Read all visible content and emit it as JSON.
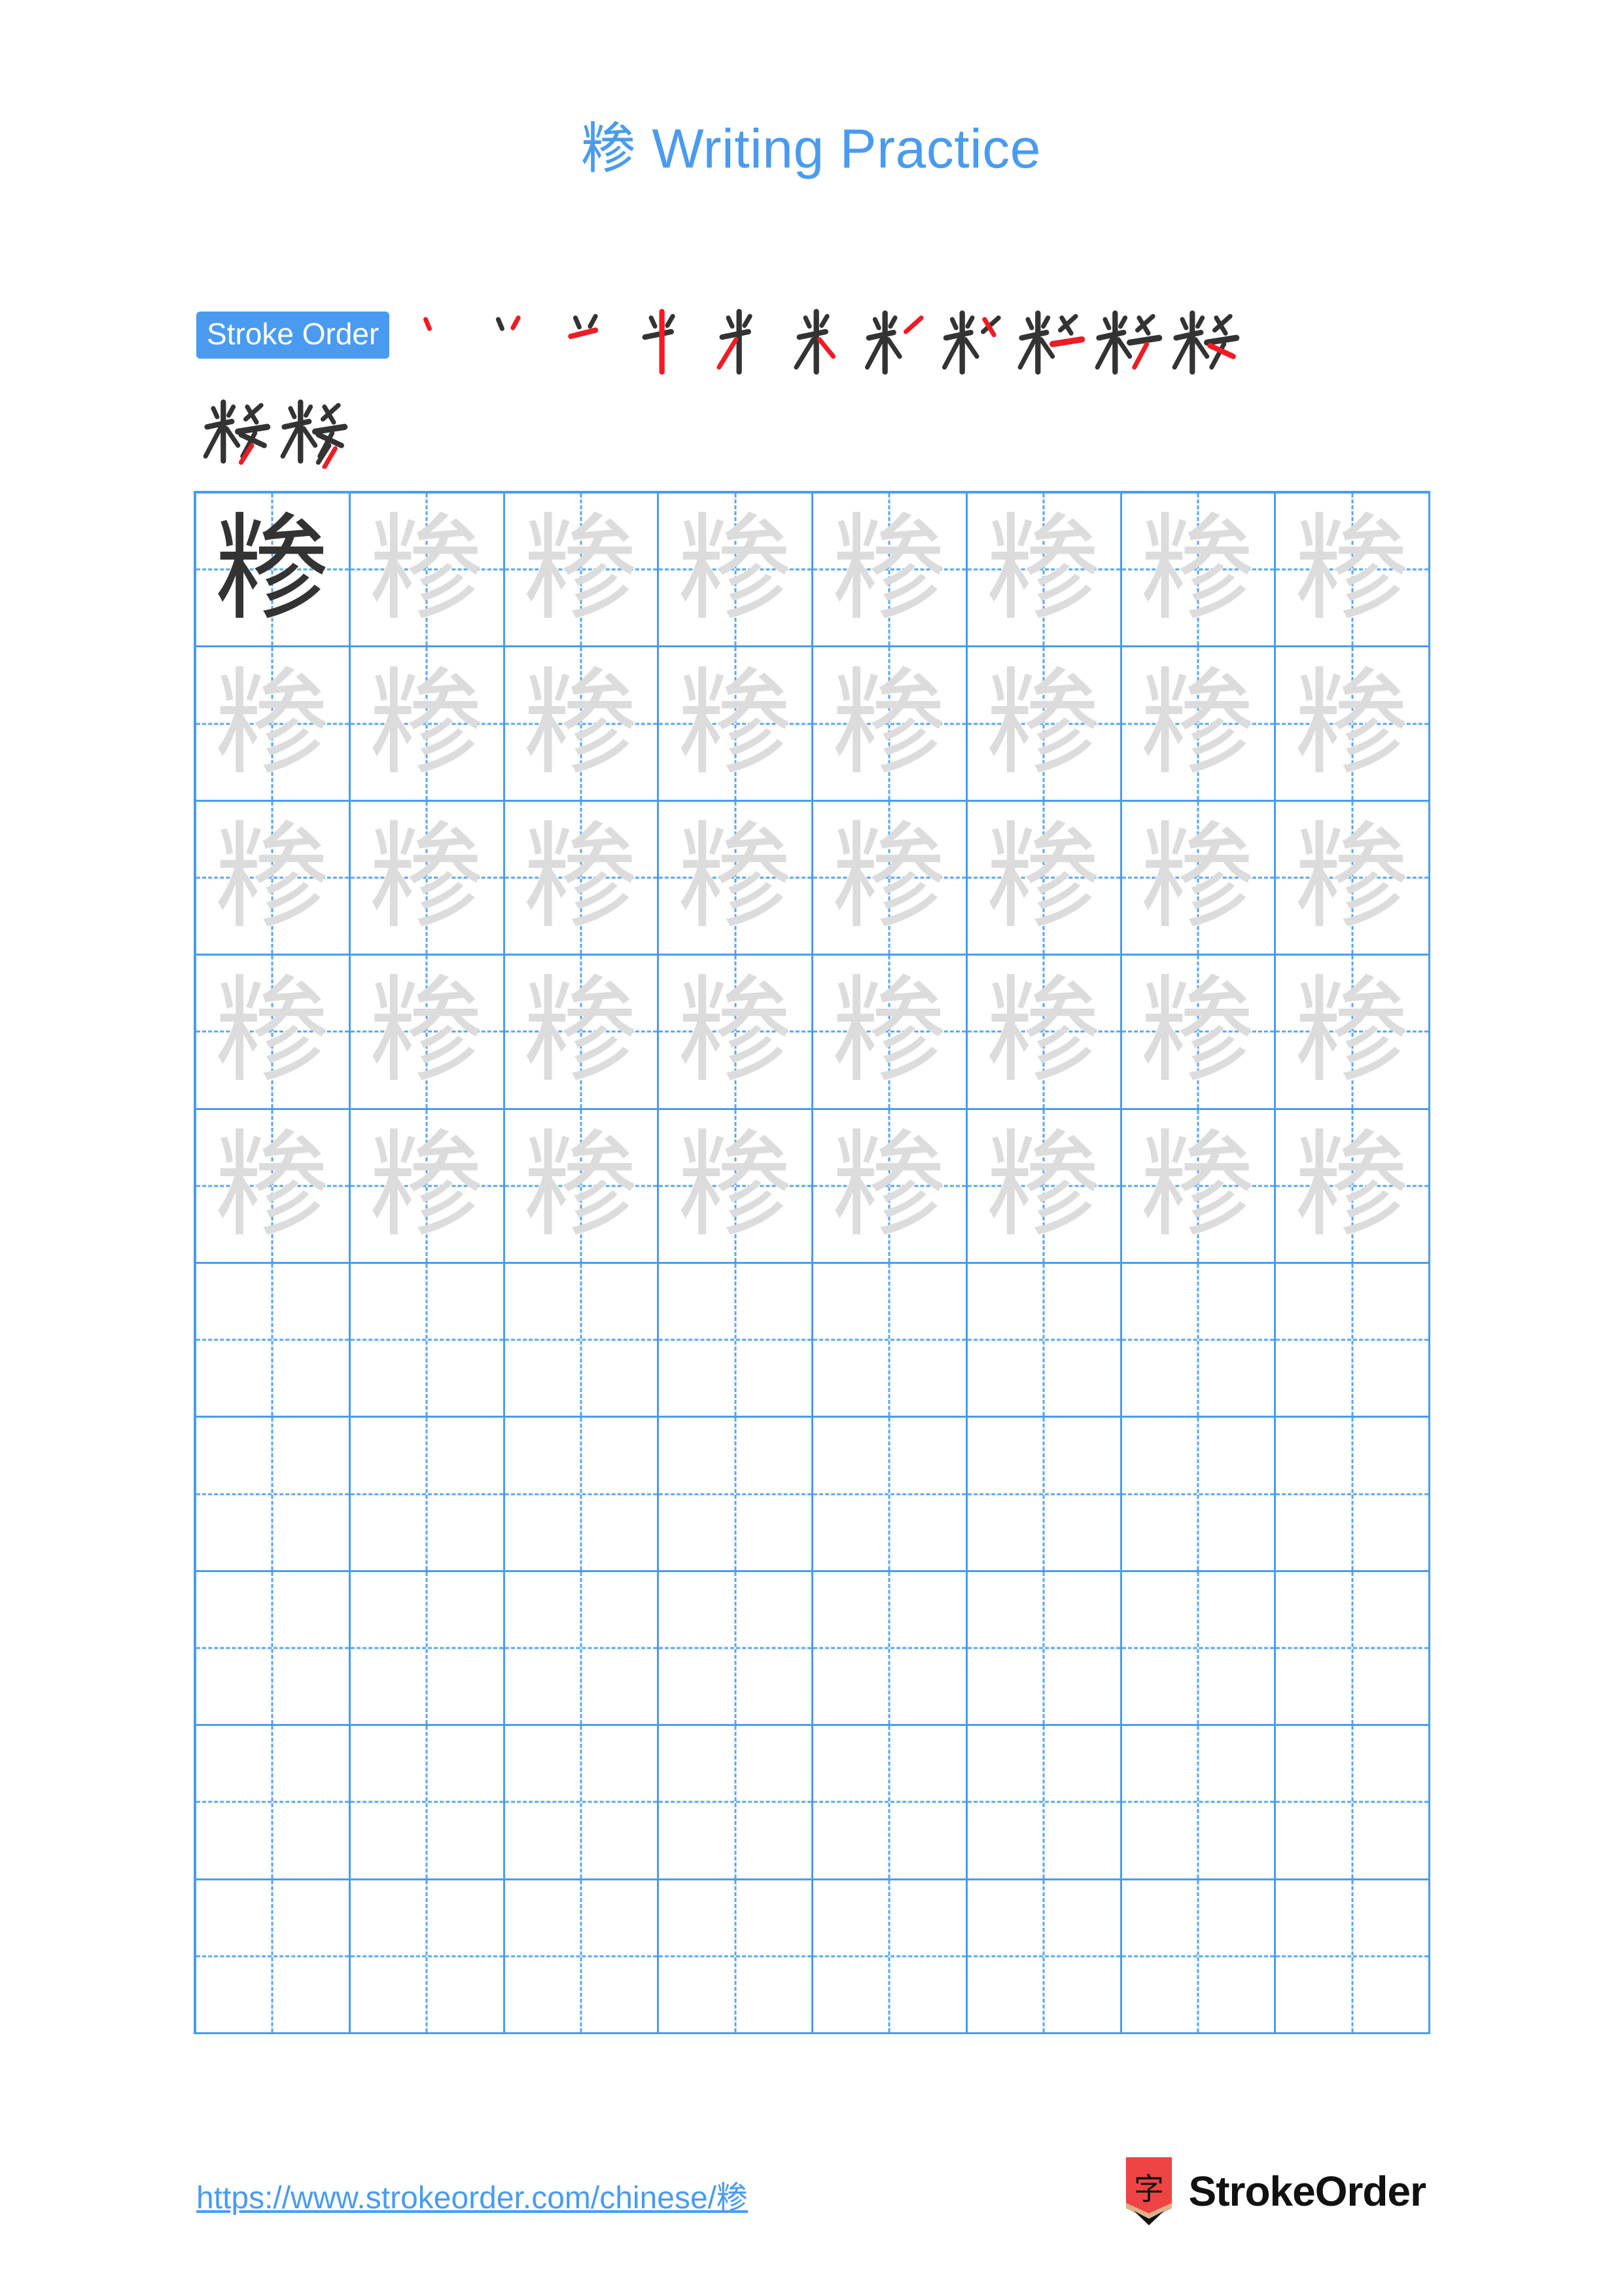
{
  "page": {
    "background": "#ffffff",
    "accent_blue": "#4a9bf0",
    "trace_gray": "#dcdcdc",
    "ink_black": "#333333",
    "highlight_red": "#ee1c25"
  },
  "header": {
    "character": "糁",
    "title_suffix": " Writing Practice",
    "title_full": "糁 Writing Practice"
  },
  "stroke_order": {
    "badge_label": "Stroke Order",
    "total_strokes": 13,
    "steps": [
      {
        "index": 1,
        "partial": "丶"
      },
      {
        "index": 2,
        "partial": "丷"
      },
      {
        "index": 3,
        "partial": "丷一"
      },
      {
        "index": 4,
        "partial": "半"
      },
      {
        "index": 5,
        "partial": "米"
      },
      {
        "index": 6,
        "partial": "米"
      },
      {
        "index": 7,
        "partial": "籵"
      },
      {
        "index": 8,
        "partial": "籵"
      },
      {
        "index": 9,
        "partial": "粆"
      },
      {
        "index": 10,
        "partial": "粂"
      },
      {
        "index": 11,
        "partial": "粋"
      },
      {
        "index": 12,
        "partial": "糁"
      },
      {
        "index": 13,
        "partial": "糁"
      }
    ],
    "row1_count": 11,
    "row2_count": 2
  },
  "practice_grid": {
    "columns": 8,
    "rows": 10,
    "character": "糁",
    "filled_rows": 5,
    "empty_rows": 5,
    "first_cell_style": "dark",
    "trace_style": "light-gray",
    "guide_lines": "dashed-cross"
  },
  "footer": {
    "url": "https://www.strokeorder.com/chinese/糁",
    "brand_name": "StrokeOrder",
    "logo_character": "字",
    "logo_body_color": "#ef4444",
    "logo_wood_color": "#d9b38c",
    "logo_tip_color": "#111111"
  }
}
